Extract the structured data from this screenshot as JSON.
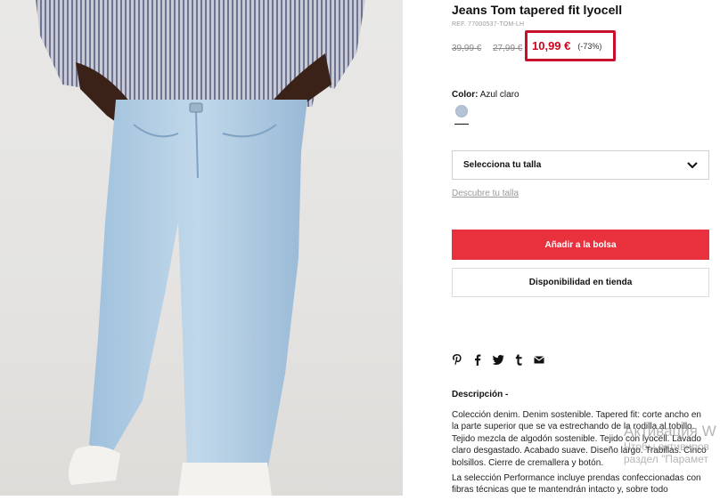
{
  "product": {
    "title": "Jeans Tom tapered fit lyocell",
    "ref": "REF. 77000537-TOM-LH",
    "old_price_1": "39,99 €",
    "old_price_2": "27,99 €",
    "price": "10,99 €",
    "discount": "(-73%)"
  },
  "color": {
    "label": "Color:",
    "value": "Azul claro",
    "swatch_hex": "#b4c4d6"
  },
  "size": {
    "select_label": "Selecciona tu talla",
    "guide_link": "Descubre tu talla"
  },
  "actions": {
    "add_to_bag": "Añadir a la bolsa",
    "store_availability": "Disponibilidad en tienda"
  },
  "share_icons": [
    "pinterest-icon",
    "facebook-icon",
    "twitter-icon",
    "tumblr-icon",
    "email-icon"
  ],
  "description": {
    "title": "Descripción",
    "toggle": "-",
    "paragraph_1": "Colección denim. Denim sostenible. Tapered fit: corte ancho en la parte superior que se va estrechando de la rodilla al tobillo. Tejido mezcla de algodón sostenible. Tejido con lyocell. Lavado claro desgastado. Acabado suave. Diseño largo. Trabillas. Cinco bolsillos. Cierre de cremallera y botón.",
    "paragraph_2": "La selección Performance incluye prendas confeccionadas con fibras técnicas que te mantendrán intacto y, sobre todo"
  },
  "watermark": {
    "line1": "Активация W",
    "line2": "Чтобы активиров",
    "line3": "раздел \"Парамет"
  },
  "colors": {
    "accent_red": "#e8313c",
    "price_red": "#d0021b",
    "highlight_border": "#c8102e"
  }
}
